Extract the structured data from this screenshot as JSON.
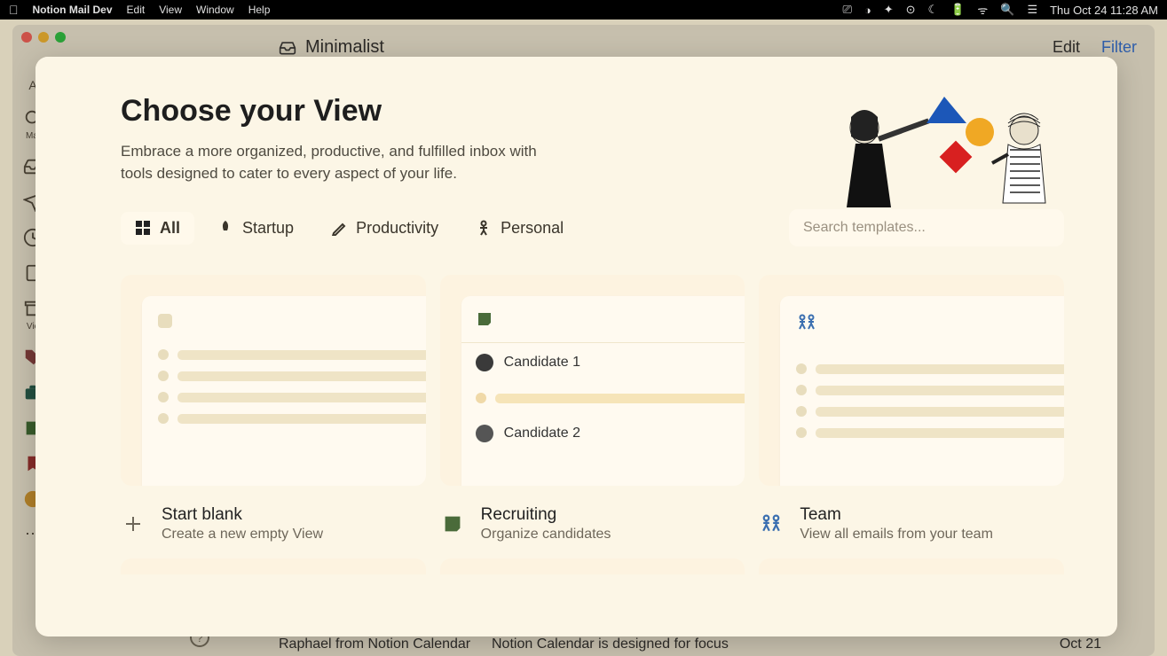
{
  "menubar": {
    "app": "Notion Mail Dev",
    "items": [
      "Edit",
      "View",
      "Window",
      "Help"
    ],
    "clock": "Thu Oct 24  11:28 AM"
  },
  "header": {
    "title": "Minimalist",
    "edit": "Edit",
    "filter": "Filter"
  },
  "sidebar": {
    "labels": [
      "A",
      "Mai",
      "Vie"
    ]
  },
  "underlay": {
    "sender": "Raphael from Notion Calendar",
    "subject": "Notion Calendar is designed for focus",
    "date": "Oct 21"
  },
  "modal": {
    "title": "Choose your View",
    "subtitle": "Embrace a more organized, productive, and fulfilled inbox with tools designed to cater to every aspect of your life.",
    "search_placeholder": "Search templates...",
    "tabs": [
      {
        "label": "All",
        "active": true
      },
      {
        "label": "Startup",
        "active": false
      },
      {
        "label": "Productivity",
        "active": false
      },
      {
        "label": "Personal",
        "active": false
      }
    ],
    "cards": [
      {
        "title": "Start blank",
        "subtitle": "Create a new empty View"
      },
      {
        "title": "Recruiting",
        "subtitle": "Organize candidates",
        "items": [
          "Candidate 1",
          "Candidate 2"
        ]
      },
      {
        "title": "Team",
        "subtitle": "View all emails from your team"
      }
    ]
  }
}
